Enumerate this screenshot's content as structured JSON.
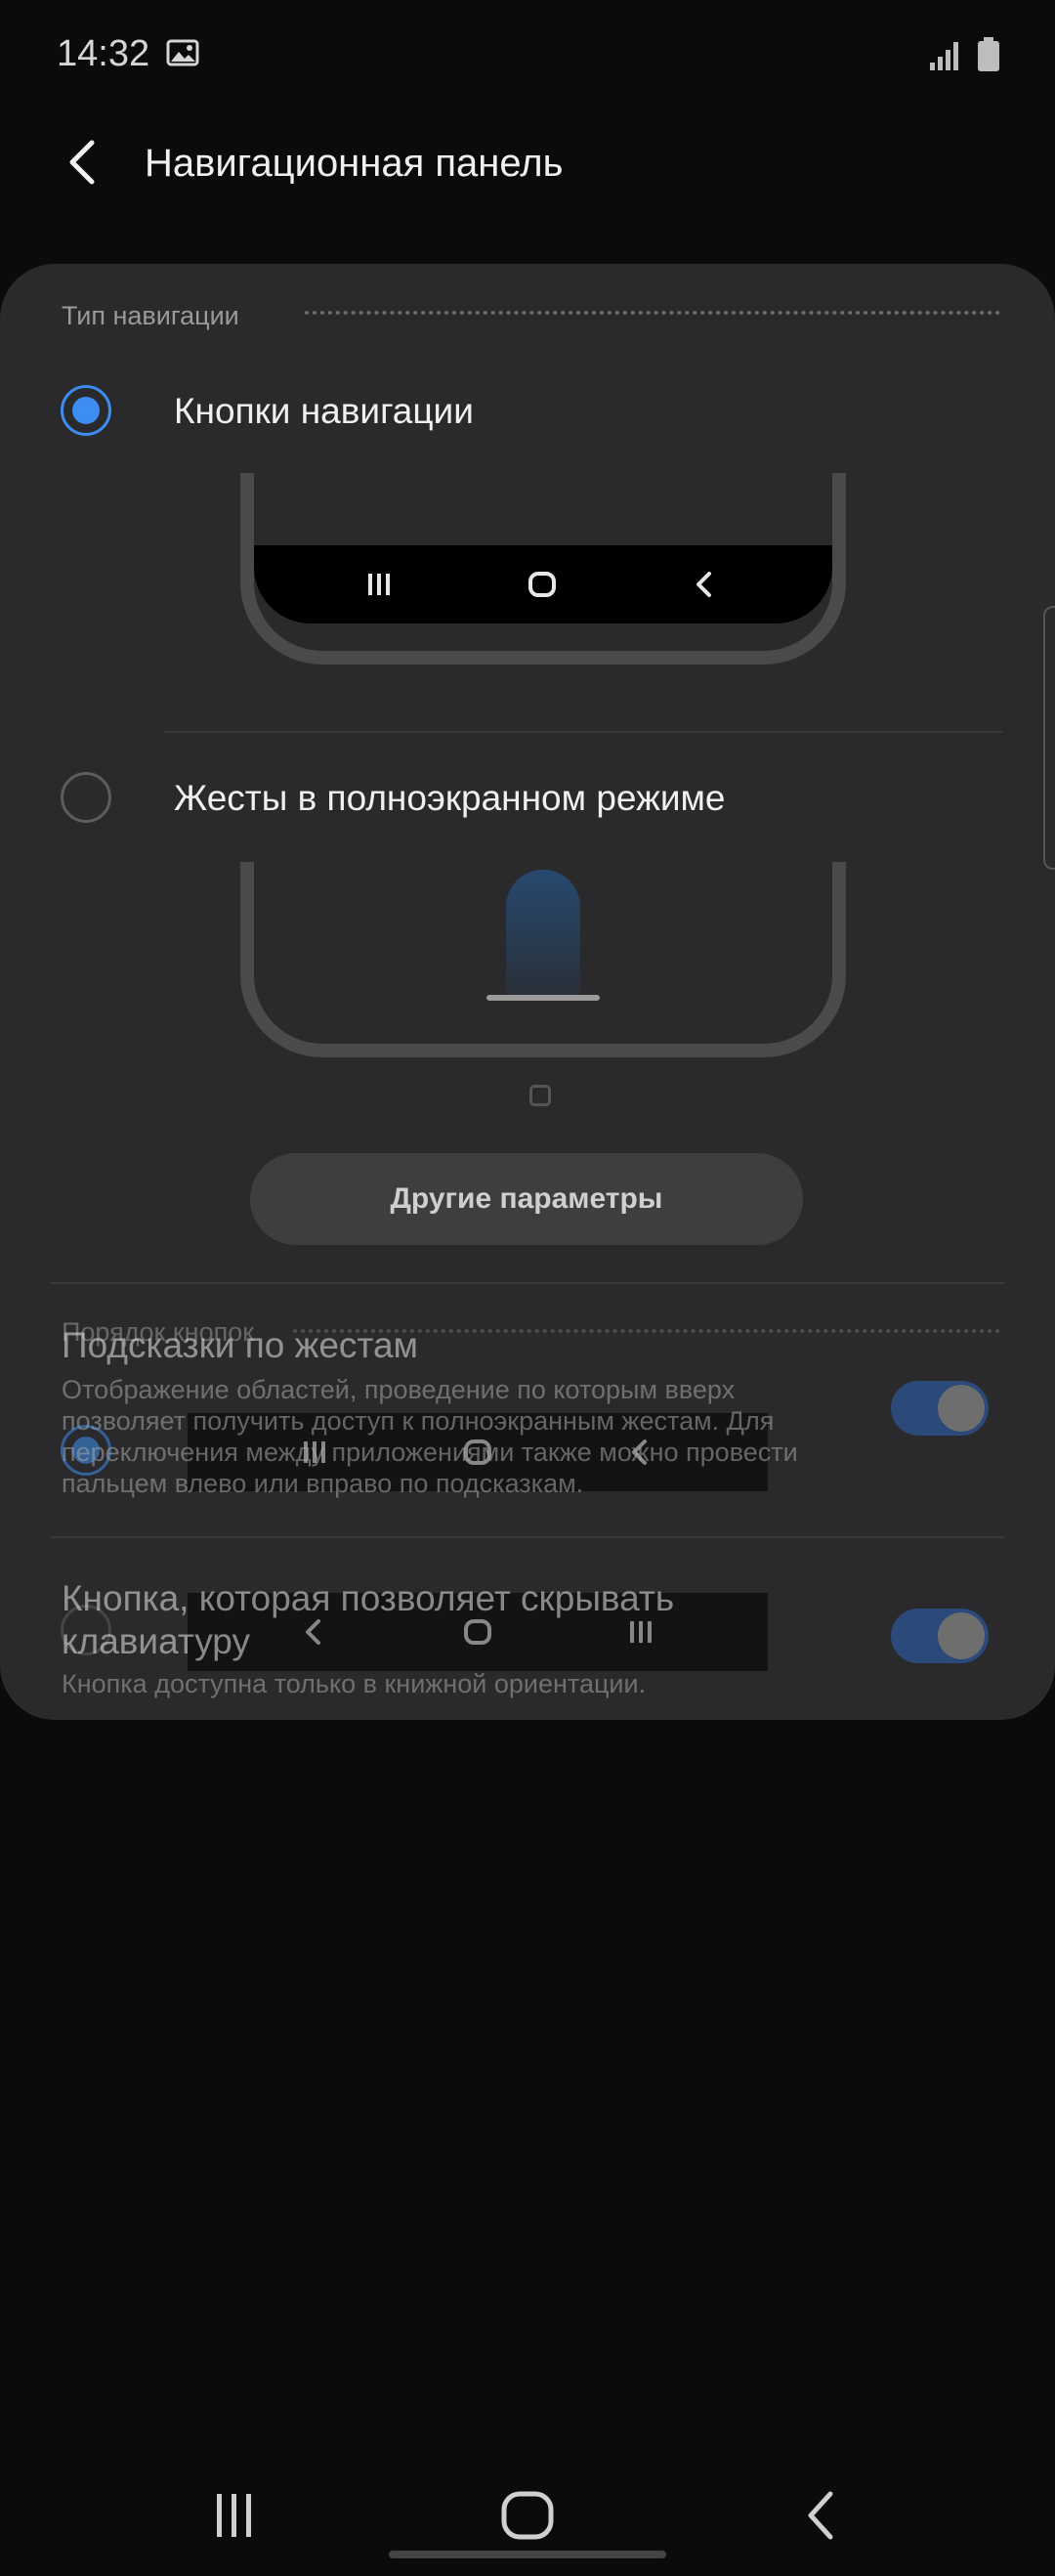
{
  "status_bar": {
    "time": "14:32",
    "icons": [
      "gallery-icon",
      "signal-icon",
      "battery-icon"
    ]
  },
  "header": {
    "title": "Навигационная панель",
    "back_icon": "chevron-left-icon"
  },
  "navigation_type": {
    "section_label": "Тип навигации",
    "options": [
      {
        "label": "Кнопки навигации",
        "selected": true
      },
      {
        "label": "Жесты в полноэкранном режиме",
        "selected": false
      }
    ],
    "more_button": "Другие параметры"
  },
  "button_order": {
    "section_label": "Порядок кнопок"
  },
  "gesture_hints": {
    "title": "Подсказки по жестам",
    "description": "Отображение областей, проведение по которым вверх позволяет получить доступ к полноэкранным жестам. Для переключения между приложениями также можно провести пальцем влево или вправо по подсказкам.",
    "enabled": true
  },
  "hide_keyboard": {
    "title": "Кнопка, которая позволяет скрывать клавиатуру",
    "description": "Кнопка доступна только в книжной ориентации.",
    "enabled": true
  },
  "colors": {
    "accent": "#3d8ef0",
    "card": "#2a2a2c",
    "background": "#0b0b0b",
    "toggle_on": "#2c64b8"
  },
  "system_nav": [
    "recents-icon",
    "home-icon",
    "back-icon"
  ]
}
